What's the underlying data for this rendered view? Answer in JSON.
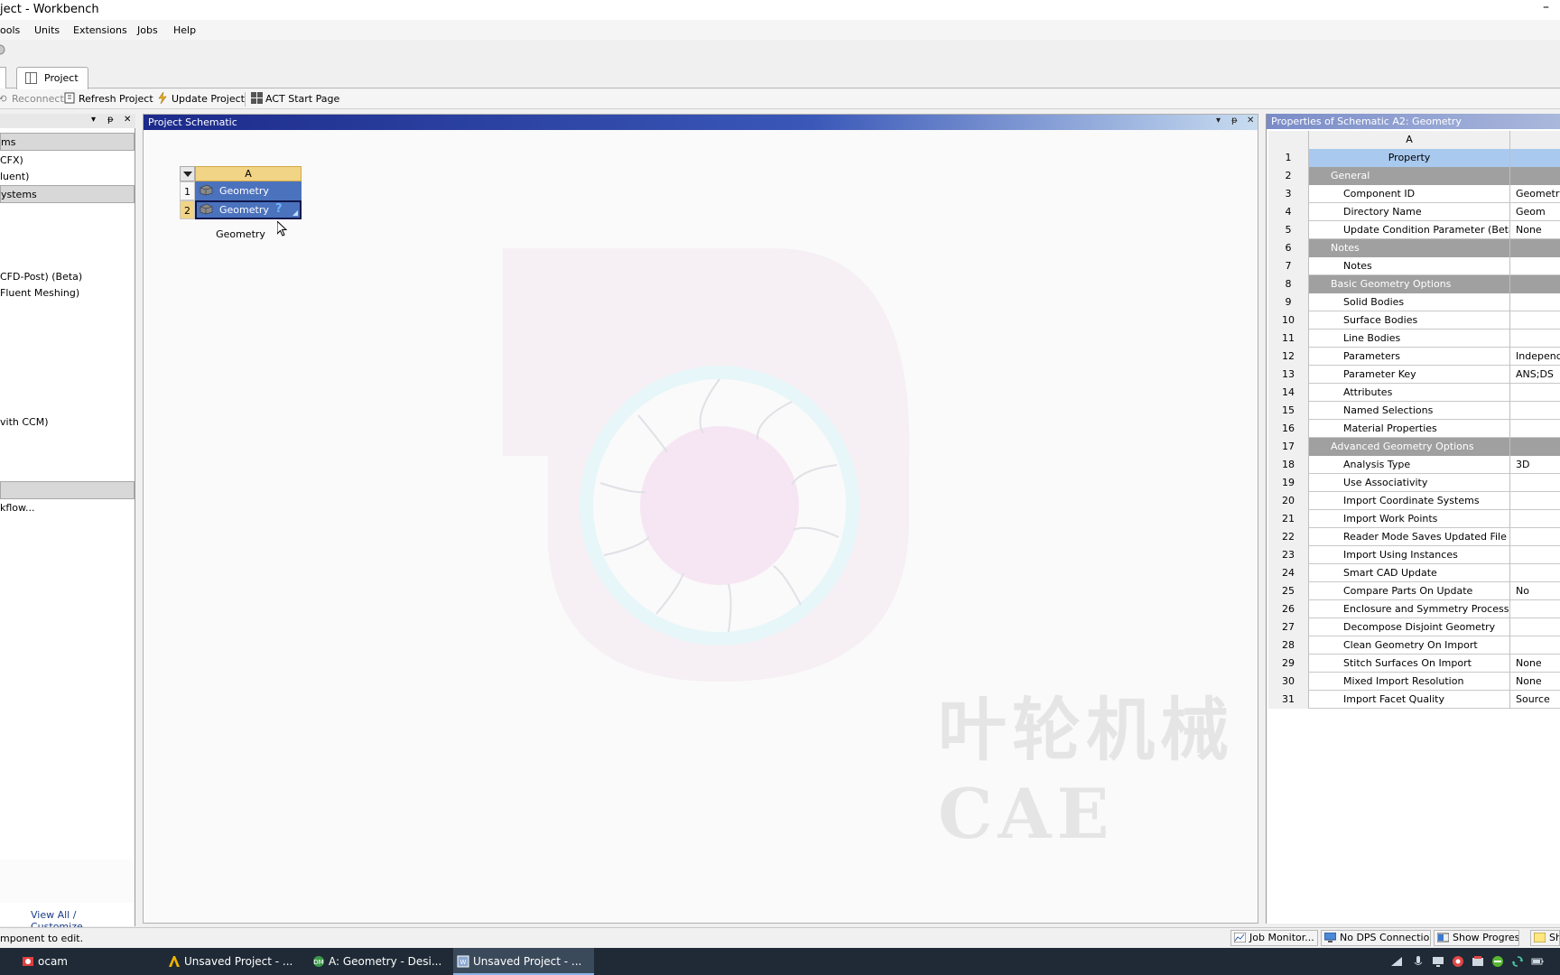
{
  "window": {
    "title": "ject - Workbench",
    "minimize_glyph": "–"
  },
  "menu": [
    "ools",
    "Units",
    "Extensions",
    "Jobs",
    "Help"
  ],
  "tabs": {
    "project": "Project"
  },
  "toolbar": {
    "reconnect": "Reconnect",
    "refresh": "Refresh Project",
    "update": "Update Project",
    "act": "ACT Start Page"
  },
  "toolbox": {
    "groups": [
      "ms",
      "ystems",
      ""
    ],
    "entries": [
      "CFX)",
      "luent)",
      "CFD-Post) (Beta)",
      "Fluent Meshing)",
      "vith CCM)",
      "kflow..."
    ],
    "view_all": "View All / Customize..."
  },
  "schematic": {
    "title": "Project Schematic",
    "controls": [
      "▾",
      "ᵽ",
      "✕"
    ],
    "system": {
      "column": "A",
      "rows": [
        {
          "num": "1",
          "label": "Geometry"
        },
        {
          "num": "2",
          "label": "Geometry",
          "status": "?"
        }
      ],
      "caption": "Geometry"
    },
    "watermark": "叶轮机械CAE"
  },
  "properties": {
    "title": "Properties of Schematic A2: Geometry",
    "column_header": "A",
    "rows": [
      {
        "num": "1",
        "kind": "prop",
        "a": "Property",
        "b": ""
      },
      {
        "num": "2",
        "kind": "cat",
        "a": "General",
        "b": ""
      },
      {
        "num": "3",
        "kind": "item",
        "a": "Component ID",
        "b": "Geometry"
      },
      {
        "num": "4",
        "kind": "item",
        "a": "Directory Name",
        "b": "Geom"
      },
      {
        "num": "5",
        "kind": "item",
        "a": "Update Condition Parameter (Beta)",
        "b": "None"
      },
      {
        "num": "6",
        "kind": "cat",
        "a": "Notes",
        "b": ""
      },
      {
        "num": "7",
        "kind": "item",
        "a": "Notes",
        "b": ""
      },
      {
        "num": "8",
        "kind": "cat",
        "a": "Basic Geometry Options",
        "b": ""
      },
      {
        "num": "9",
        "kind": "item",
        "a": "Solid Bodies",
        "b": ""
      },
      {
        "num": "10",
        "kind": "item",
        "a": "Surface Bodies",
        "b": ""
      },
      {
        "num": "11",
        "kind": "item",
        "a": "Line Bodies",
        "b": ""
      },
      {
        "num": "12",
        "kind": "item",
        "a": "Parameters",
        "b": "Independe"
      },
      {
        "num": "13",
        "kind": "item",
        "a": "Parameter Key",
        "b": "ANS;DS"
      },
      {
        "num": "14",
        "kind": "item",
        "a": "Attributes",
        "b": ""
      },
      {
        "num": "15",
        "kind": "item",
        "a": "Named Selections",
        "b": ""
      },
      {
        "num": "16",
        "kind": "item",
        "a": "Material Properties",
        "b": ""
      },
      {
        "num": "17",
        "kind": "cat",
        "a": "Advanced Geometry Options",
        "b": ""
      },
      {
        "num": "18",
        "kind": "item",
        "a": "Analysis Type",
        "b": "3D"
      },
      {
        "num": "19",
        "kind": "item",
        "a": "Use Associativity",
        "b": ""
      },
      {
        "num": "20",
        "kind": "item",
        "a": "Import Coordinate Systems",
        "b": ""
      },
      {
        "num": "21",
        "kind": "item",
        "a": "Import Work Points",
        "b": ""
      },
      {
        "num": "22",
        "kind": "item",
        "a": "Reader Mode Saves Updated File",
        "b": ""
      },
      {
        "num": "23",
        "kind": "item",
        "a": "Import Using Instances",
        "b": ""
      },
      {
        "num": "24",
        "kind": "item",
        "a": "Smart CAD Update",
        "b": ""
      },
      {
        "num": "25",
        "kind": "item",
        "a": "Compare Parts On Update",
        "b": "No"
      },
      {
        "num": "26",
        "kind": "item",
        "a": "Enclosure and Symmetry Processing",
        "b": ""
      },
      {
        "num": "27",
        "kind": "item",
        "a": "Decompose Disjoint Geometry",
        "b": ""
      },
      {
        "num": "28",
        "kind": "item",
        "a": "Clean Geometry On Import",
        "b": ""
      },
      {
        "num": "29",
        "kind": "item",
        "a": "Stitch Surfaces On Import",
        "b": "None"
      },
      {
        "num": "30",
        "kind": "item",
        "a": "Mixed Import Resolution",
        "b": "None"
      },
      {
        "num": "31",
        "kind": "item",
        "a": "Import Facet Quality",
        "b": "Source"
      }
    ]
  },
  "status": {
    "message": "mponent to edit.",
    "job_monitor": "Job Monitor...",
    "dps": "No DPS Connection",
    "progress": "Show Progress",
    "show": "Sho"
  },
  "taskbar": {
    "items": [
      "ocam",
      "Unsaved Project - ...",
      "A: Geometry - Desi...",
      "Unsaved Project - ..."
    ]
  },
  "colors": {
    "accent": "#1c2a8a",
    "selection": "#4b72bd",
    "header_row": "#a9c9ee",
    "category": "#a0a0a0"
  }
}
